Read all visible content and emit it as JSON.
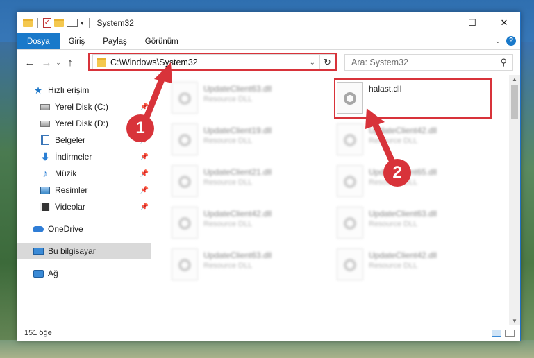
{
  "window": {
    "title": "System32",
    "controls": [
      "—",
      "☐",
      "✕"
    ]
  },
  "ribbon": {
    "tabs": [
      "Dosya",
      "Giriş",
      "Paylaş",
      "Görünüm"
    ],
    "help": "?"
  },
  "navigation": {
    "back": "←",
    "forward": "→",
    "recent": "⌄",
    "up": "↑",
    "address": "C:\\Windows\\System32",
    "search_placeholder": "Ara: System32"
  },
  "sidebar": {
    "items": [
      {
        "label": "Hızlı erişim",
        "icon": "star-icon"
      },
      {
        "label": "Yerel Disk (C:)",
        "icon": "drive-icon",
        "pinned": true
      },
      {
        "label": "Yerel Disk (D:)",
        "icon": "drive-icon",
        "pinned": true
      },
      {
        "label": "Belgeler",
        "icon": "document-icon",
        "pinned": true
      },
      {
        "label": "İndirmeler",
        "icon": "download-icon",
        "pinned": true
      },
      {
        "label": "Müzik",
        "icon": "music-icon",
        "pinned": true
      },
      {
        "label": "Resimler",
        "icon": "pictures-icon",
        "pinned": true
      },
      {
        "label": "Videolar",
        "icon": "video-icon",
        "pinned": true
      },
      {
        "label": "OneDrive",
        "icon": "cloud-icon"
      },
      {
        "label": "Bu bilgisayar",
        "icon": "computer-icon",
        "selected": true
      },
      {
        "label": "Ağ",
        "icon": "network-icon"
      }
    ]
  },
  "files": [
    {
      "name": "UpdateClient63.dll",
      "type": "Resource DLL",
      "blurred": true
    },
    {
      "name": "halast.dll",
      "type": "",
      "blurred": false,
      "highlighted": true
    },
    {
      "name": "UpdateClient19.dll",
      "type": "Resource DLL",
      "blurred": true
    },
    {
      "name": "UpdateClient42.dll",
      "type": "Resource DLL",
      "blurred": true
    },
    {
      "name": "UpdateClient21.dll",
      "type": "Resource DLL",
      "blurred": true
    },
    {
      "name": "UpdateClient65.dll",
      "type": "Resource DLL",
      "blurred": true
    },
    {
      "name": "UpdateClient42.dll",
      "type": "Resource DLL",
      "blurred": true
    },
    {
      "name": "UpdateClient63.dll",
      "type": "Resource DLL",
      "blurred": true
    },
    {
      "name": "UpdateClient63.dll",
      "type": "Resource DLL",
      "blurred": true
    },
    {
      "name": "UpdateClient42.dll",
      "type": "Resource DLL",
      "blurred": true
    }
  ],
  "status": {
    "count": "151 öğe"
  },
  "annotations": {
    "step1": "1",
    "step2": "2",
    "color": "#d8333a"
  }
}
